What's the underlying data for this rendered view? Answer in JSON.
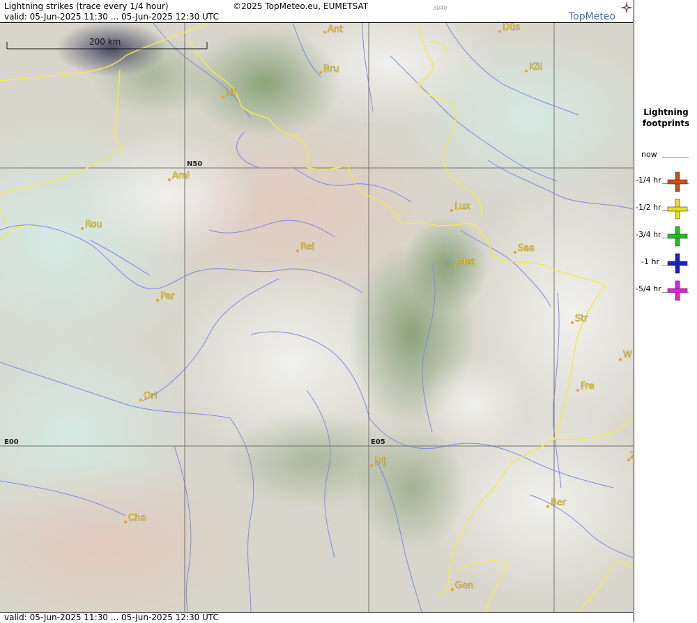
{
  "header": {
    "title": "Lightning strikes (trace every 1/4 hour)",
    "valid": "valid:  05-Jun-2025 11:30 ... 05-Jun-2025 12:30 UTC",
    "copyright": "©2025 TopMeteo.eu, EUMETSAT",
    "code": "3040",
    "logo": "TopMeteo"
  },
  "footer": {
    "valid": "valid:  05-Jun-2025 11:30 ... 05-Jun-2025 12:30 UTC"
  },
  "map": {
    "scale_label": "200 km",
    "grid_labels": {
      "lat": "N50",
      "lon0": "E00",
      "lon5": "E05"
    },
    "cities": [
      {
        "name": "Ant"
      },
      {
        "name": "Düs"
      },
      {
        "name": "Bru"
      },
      {
        "name": "Köl"
      },
      {
        "name": "Lil"
      },
      {
        "name": "Ami"
      },
      {
        "name": "Rou"
      },
      {
        "name": "Lux"
      },
      {
        "name": "Rei"
      },
      {
        "name": "Saa"
      },
      {
        "name": "Met"
      },
      {
        "name": "Par"
      },
      {
        "name": "Str"
      },
      {
        "name": "W"
      },
      {
        "name": "Fre"
      },
      {
        "name": "Orl"
      },
      {
        "name": "Dij"
      },
      {
        "name": "Z"
      },
      {
        "name": "Ber"
      },
      {
        "name": "Cha"
      },
      {
        "name": "Gen"
      }
    ]
  },
  "legend": {
    "title_line1": "Lightning",
    "title_line2": "footprints",
    "items": [
      {
        "label": "now",
        "color": ""
      },
      {
        "label": "-1/4 hr",
        "color": "#c8501e"
      },
      {
        "label": "-1/2 hr",
        "color": "#e8e020"
      },
      {
        "label": "-3/4 hr",
        "color": "#20c020"
      },
      {
        "label": "-1 hr",
        "color": "#1820c0"
      },
      {
        "label": "-5/4 hr",
        "color": "#e020e0"
      }
    ]
  },
  "colors": {
    "border": "#f5e94a",
    "river": "#7f86e6",
    "grid": "#707070"
  }
}
